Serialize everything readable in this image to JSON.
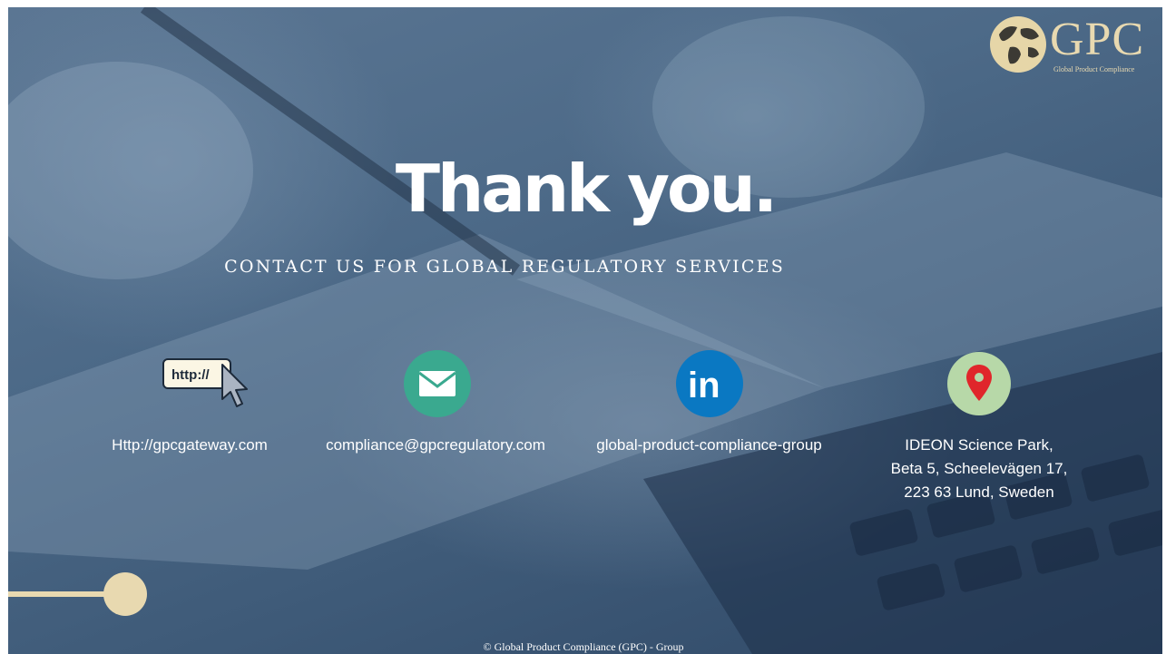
{
  "logo": {
    "text": "GPC",
    "subtitle": "Global Product Compliance"
  },
  "heading": "Thank you.",
  "subheading": "CONTACT US FOR GLOBAL REGULATORY SERVICES",
  "contacts": {
    "website": {
      "icon": "http-cursor-icon",
      "badge": "http://",
      "text": "Http://gpcgateway.com"
    },
    "email": {
      "icon": "envelope-icon",
      "text": "compliance@gpcregulatory.com",
      "color": "#3aa98f"
    },
    "linkedin": {
      "icon": "linkedin-icon",
      "badge": "in",
      "text": "global-product-compliance-group",
      "color": "#0a78c2"
    },
    "address": {
      "icon": "map-pin-icon",
      "lines": [
        "IDEON Science Park,",
        "Beta 5, Scheelevägen 17,",
        "223 63 Lund, Sweden"
      ],
      "color": "#b7d8a8"
    }
  },
  "footer": "© Global Product Compliance (GPC) - Group",
  "colors": {
    "accent": "#e8d9b0",
    "background": "#4d6a88"
  }
}
